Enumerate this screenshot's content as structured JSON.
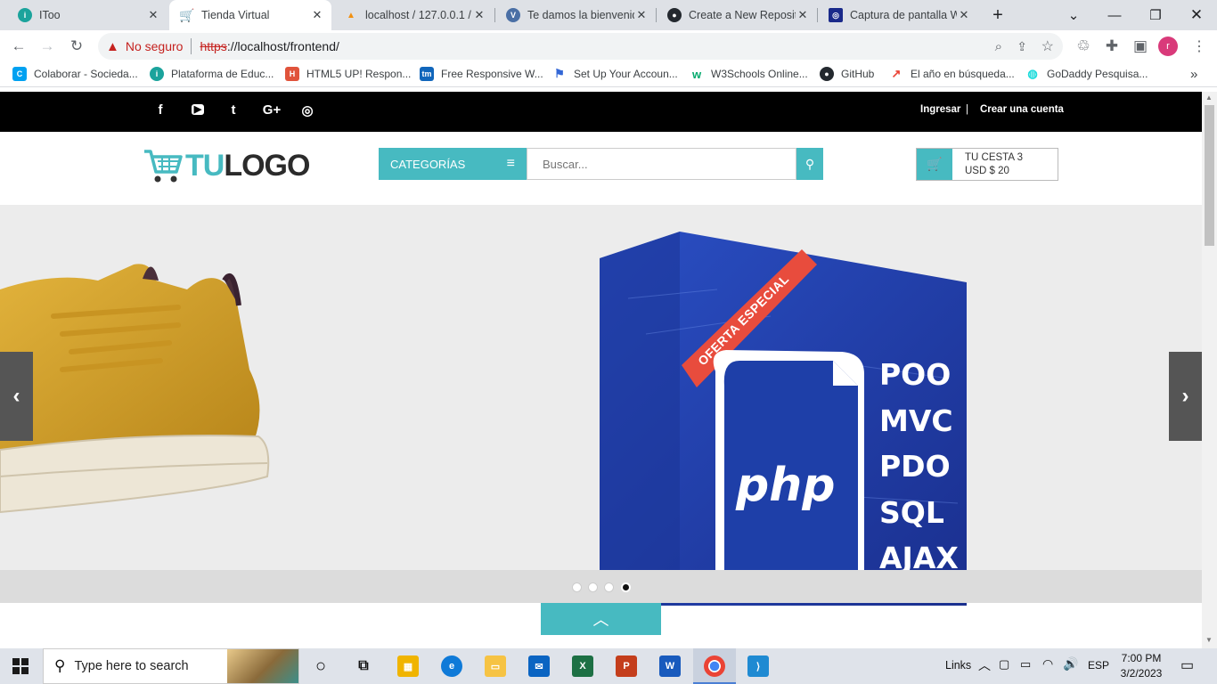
{
  "browser": {
    "tabs": [
      {
        "title": "IToo",
        "active": false,
        "fav_color": "#1ba39c"
      },
      {
        "title": "Tienda Virtual",
        "active": true,
        "fav_color": "#47bac1"
      },
      {
        "title": "localhost / 127.0.0.1 /",
        "active": false,
        "fav_color": "#f29111"
      },
      {
        "title": "Te damos la bienvenid",
        "active": false,
        "fav_color": "#4a6fa5"
      },
      {
        "title": "Create a New Reposito",
        "active": false,
        "fav_color": "#24292f"
      },
      {
        "title": "Captura de pantalla W",
        "active": false,
        "fav_color": "#1a2a8a"
      }
    ],
    "new_tab_label": "+",
    "security_label": "No seguro",
    "url_scheme": "https",
    "url_rest": "://localhost/frontend/",
    "profile_initial": "r",
    "bookmarks": [
      {
        "label": "Colaborar - Socieda...",
        "color": "#00a1f1",
        "glyph": "C"
      },
      {
        "label": "Plataforma de Educ...",
        "color": "#1ba39c",
        "glyph": "i"
      },
      {
        "label": "HTML5 UP! Respon...",
        "color": "#e0533b",
        "glyph": "H"
      },
      {
        "label": "Free Responsive W...",
        "color": "#1166bb",
        "glyph": "tm"
      },
      {
        "label": "Set Up Your Accoun...",
        "color": "#3367d6",
        "glyph": "⚑"
      },
      {
        "label": "W3Schools Online...",
        "color": "#04aa6d",
        "glyph": "w"
      },
      {
        "label": "GitHub",
        "color": "#24292f",
        "glyph": "G"
      },
      {
        "label": "El año en búsqueda...",
        "color": "#ea4335",
        "glyph": "↗"
      },
      {
        "label": "GoDaddy Pesquisa...",
        "color": "#1bdbdb",
        "glyph": "G"
      }
    ],
    "more_bookmarks": "»"
  },
  "site": {
    "topbar": {
      "social": [
        "f",
        "▶",
        "t",
        "G+",
        "◎"
      ],
      "login_label": "Ingresar",
      "separator": "|",
      "register_label": "Crear una cuenta"
    },
    "logo": {
      "part1": "TU",
      "part2": "LOGO"
    },
    "categories_label": "CATEGORÍAS",
    "search_placeholder": "Buscar...",
    "cart": {
      "line1": "TU CESTA 3",
      "line2": "USD $ 20"
    },
    "slide": {
      "ribbon": "OFERTA ESPECIAL",
      "logo_text": "php",
      "topics": [
        "POO",
        "MVC",
        "PDO",
        "SQL",
        "AJAX"
      ],
      "active_dot": 3,
      "dot_count": 4
    },
    "colors": {
      "accent": "#47bac1",
      "topbar": "#000000",
      "box": "#1e3fa8"
    }
  },
  "taskbar": {
    "search_placeholder": "Type here to search",
    "links_label": "Links",
    "lang": "ESP",
    "time": "7:00 PM",
    "date": "3/2/2023"
  }
}
